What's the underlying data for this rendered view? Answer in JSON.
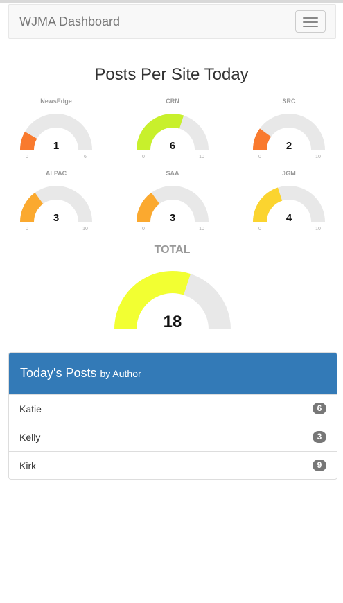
{
  "navbar": {
    "brand": "WJMA Dashboard",
    "menu_icon": "hamburger-menu-icon"
  },
  "section_title": "Posts Per Site Today",
  "site_gauges": [
    {
      "name": "NewsEdge",
      "value": 1,
      "min": 0,
      "max": 6,
      "color": "#f97a2e"
    },
    {
      "name": "CRN",
      "value": 6,
      "min": 0,
      "max": 10,
      "color": "#c8f02c"
    },
    {
      "name": "SRC",
      "value": 2,
      "min": 0,
      "max": 10,
      "color": "#f97a2e"
    },
    {
      "name": "ALPAC",
      "value": 3,
      "min": 0,
      "max": 10,
      "color": "#fba92f"
    },
    {
      "name": "SAA",
      "value": 3,
      "min": 0,
      "max": 10,
      "color": "#fba92f"
    },
    {
      "name": "JGM",
      "value": 4,
      "min": 0,
      "max": 10,
      "color": "#fbd42f"
    }
  ],
  "total": {
    "label": "TOTAL",
    "value": 18,
    "min": 0,
    "max": 30,
    "color": "#f2ff32"
  },
  "author_panel": {
    "title": "Today's Posts",
    "subtitle": "by Author",
    "rows": [
      {
        "name": "Katie",
        "count": "6"
      },
      {
        "name": "Kelly",
        "count": "3"
      },
      {
        "name": "Kirk",
        "count": "9"
      }
    ]
  }
}
